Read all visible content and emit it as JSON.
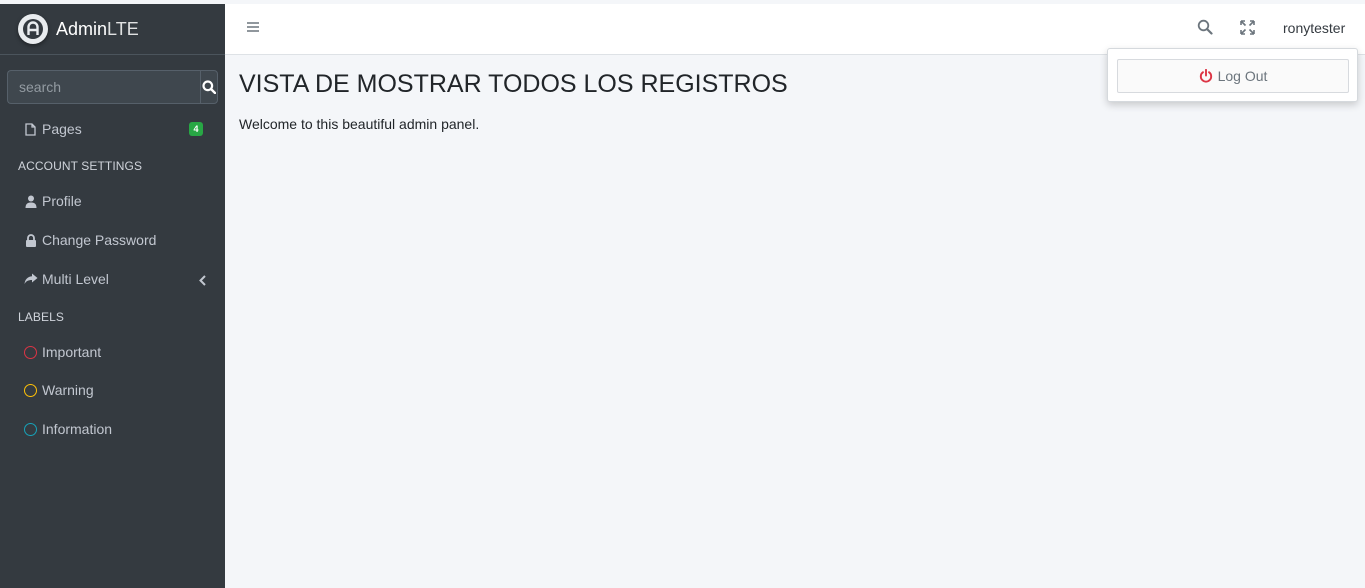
{
  "brand": {
    "bold": "Admin",
    "light": "LTE"
  },
  "search": {
    "placeholder": "search"
  },
  "sidebar": {
    "pages": {
      "label": "Pages",
      "badge": "4"
    },
    "account_header": "ACCOUNT SETTINGS",
    "profile": "Profile",
    "change_password": "Change Password",
    "multi_level": "Multi Level",
    "labels_header": "LABELS",
    "important": "Important",
    "warning": "Warning",
    "information": "Information"
  },
  "topbar": {
    "username": "ronytester"
  },
  "dropdown": {
    "logout": "Log Out"
  },
  "content": {
    "title": "VISTA DE MOSTRAR TODOS LOS REGISTROS",
    "welcome": "Welcome to this beautiful admin panel."
  },
  "colors": {
    "sidebar_bg": "#343a40",
    "badge": "#28a745",
    "important": "#dc3545",
    "warning": "#ffc107",
    "information": "#17a2b8",
    "logout_icon": "#dc3545"
  }
}
